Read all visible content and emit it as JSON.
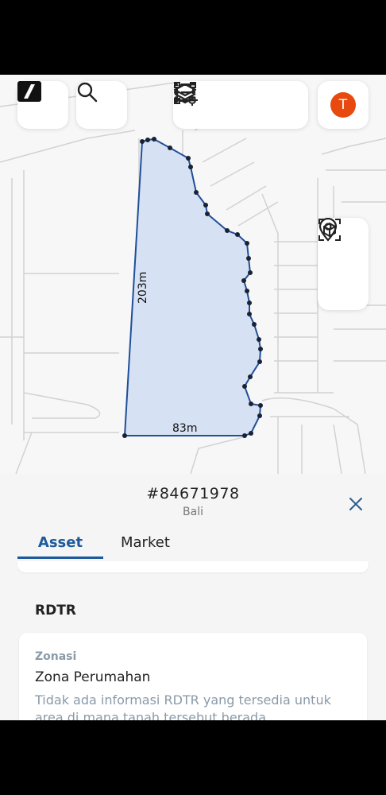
{
  "map": {
    "measurements": {
      "left_side": "203m",
      "bottom_side": "83m"
    },
    "colors": {
      "parcel_fill": "#d6e1f3",
      "parcel_stroke": "#1f4f9a",
      "vertex": "#1a2233",
      "road": "#d2d2d2"
    }
  },
  "toolbar": {
    "logo_icon": "brand-logo-icon",
    "search_icon": "search-icon",
    "tools": [
      "layers-icon",
      "list-icon",
      "polygon-settings-icon"
    ],
    "avatar_letter": "T",
    "avatar_color": "#e8490f"
  },
  "side_controls": [
    "location-pin-icon",
    "3d-box-icon"
  ],
  "sheet": {
    "parcel_id": "#84671978",
    "region": "Bali",
    "tabs": [
      {
        "label": "Asset",
        "active": true
      },
      {
        "label": "Market",
        "active": false
      }
    ],
    "section_title": "RDTR",
    "card": {
      "label": "Zonasi",
      "value": "Zona Perumahan",
      "description": "Tidak ada informasi RDTR yang tersedia untuk area di mana tanah tersebut berada"
    }
  }
}
